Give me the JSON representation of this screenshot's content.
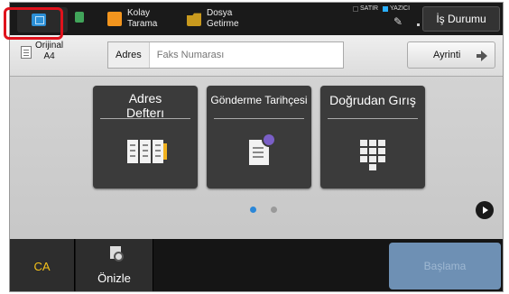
{
  "topbar": {
    "scan_label": [
      "Kolay",
      "Tarama"
    ],
    "file_label": [
      "Dosya",
      "Getirme"
    ],
    "status_line": "SATIR",
    "status_printer": "YAZICI",
    "job_status": "İş Durumu",
    "colors": {
      "line_status": "#111111",
      "printer_status": "#2ab0ff"
    }
  },
  "original": {
    "label": "Orijinal",
    "size": "A4"
  },
  "address": {
    "label": "Adres",
    "placeholder": "Faks Numarası",
    "detail_button": "Ayrinti"
  },
  "cards": [
    {
      "title_lines": [
        "Adres",
        "Defterı"
      ],
      "icon": "address-book-icon"
    },
    {
      "title_lines": [
        "Gönderme Tarihçesi"
      ],
      "icon": "send-history-icon"
    },
    {
      "title_lines": [
        "Doğrudan Gırış"
      ],
      "icon": "keypad-icon"
    }
  ],
  "pager": {
    "page_count": 2,
    "active_page": 1,
    "active_color": "#2b87d8",
    "inactive_color": "#9a9a9a"
  },
  "bottom": {
    "clear_all": "CA",
    "preview": "Önizle",
    "start": "Başlama",
    "start_color": "#6e90b4"
  }
}
